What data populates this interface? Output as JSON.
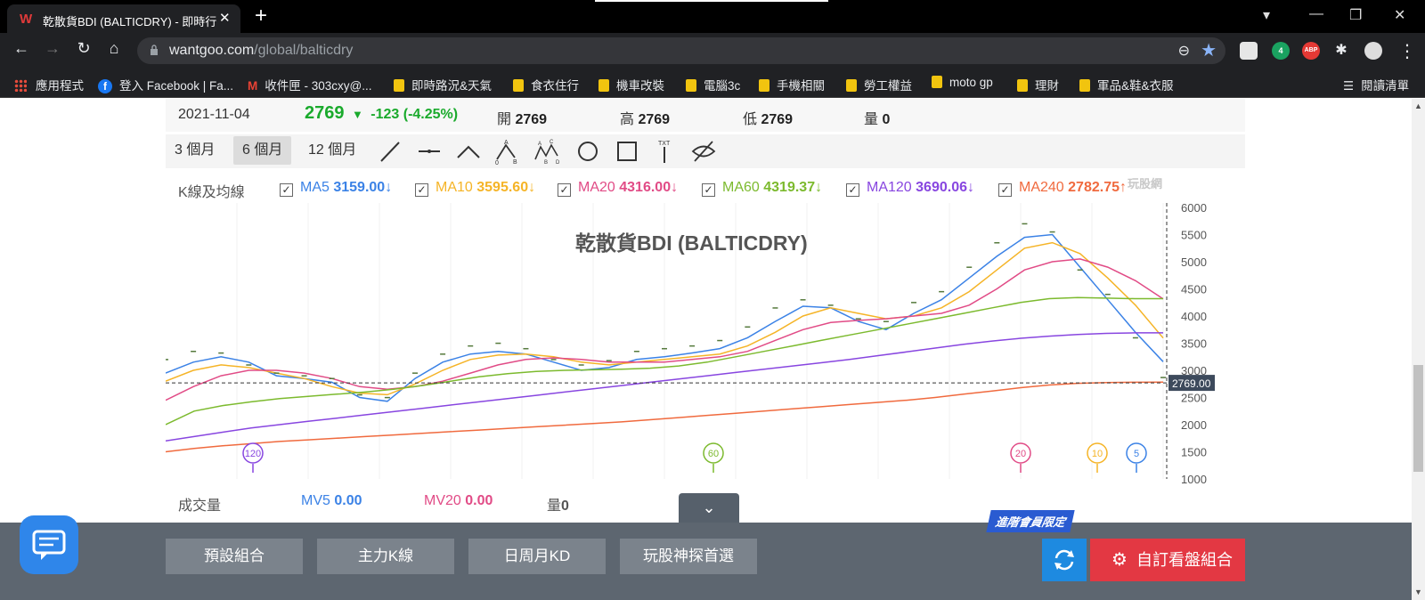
{
  "browser": {
    "tab_title": "乾散貨BDI (BALTICDRY) - 即時行",
    "tab_logo": "W",
    "url_host": "wantgoo.com",
    "url_path": "/global/balticdry",
    "ext_badge": "4",
    "ext_abp": "ABP"
  },
  "bookmarks": [
    {
      "label": "應用程式",
      "icon": "apps-icon"
    },
    {
      "label": "登入 Facebook | Fa...",
      "icon": "facebook-icon"
    },
    {
      "label": "收件匣 - 303cxy@...",
      "icon": "gmail-icon"
    },
    {
      "label": "即時路況&天氣",
      "icon": "folder-icon"
    },
    {
      "label": "食衣住行",
      "icon": "folder-icon"
    },
    {
      "label": "機車改裝",
      "icon": "folder-icon"
    },
    {
      "label": "電腦3c",
      "icon": "folder-icon"
    },
    {
      "label": "手機相關",
      "icon": "folder-icon"
    },
    {
      "label": "勞工權益",
      "icon": "folder-icon"
    },
    {
      "label": "moto gp",
      "icon": "folder-icon"
    },
    {
      "label": "理財",
      "icon": "folder-icon"
    },
    {
      "label": "軍品&鞋&衣服",
      "icon": "folder-icon"
    }
  ],
  "reading_list": "閱讀清單",
  "quote": {
    "date": "2021-11-04",
    "price": "2769",
    "change": "-123 (-4.25%)",
    "open_label": "開",
    "open": "2769",
    "high_label": "高",
    "high": "2769",
    "low_label": "低",
    "low": "2769",
    "volume_label": "量",
    "volume": "0"
  },
  "periods": [
    "3 個月",
    "6 個月",
    "12 個月"
  ],
  "active_period": "6 個月",
  "ma_section_label": "K線及均線",
  "ma_lines": [
    {
      "name": "MA5",
      "value": "3159.00",
      "arrow": "↓",
      "color": "#3b82e6"
    },
    {
      "name": "MA10",
      "value": "3595.60",
      "arrow": "↓",
      "color": "#f5b427"
    },
    {
      "name": "MA20",
      "value": "4316.00",
      "arrow": "↓",
      "color": "#e14b86"
    },
    {
      "name": "MA60",
      "value": "4319.37",
      "arrow": "↓",
      "color": "#7cba2e"
    },
    {
      "name": "MA120",
      "value": "3690.06",
      "arrow": "↓",
      "color": "#8846e0"
    },
    {
      "name": "MA240",
      "value": "2782.75",
      "arrow": "↑",
      "color": "#f06a3e"
    }
  ],
  "watermark": "玩股網",
  "volume_section": {
    "label": "成交量",
    "mv5_name": "MV5",
    "mv5": "0.00",
    "mv20_name": "MV20",
    "mv20": "0.00",
    "vol_name": "量",
    "vol": "0"
  },
  "footer": {
    "buttons": [
      "預設組合",
      "主力K線",
      "日周月KD",
      "玩股神探首選"
    ],
    "badge": "進階會員限定",
    "custom_button": "自訂看盤組合"
  },
  "chart_data": {
    "type": "line",
    "title": "乾散貨BDI (BALTICDRY)",
    "ylim": [
      1000,
      6000
    ],
    "y_ticks": [
      6000,
      5500,
      5000,
      4500,
      4000,
      3500,
      3000,
      2500,
      2000,
      1500,
      1000
    ],
    "current_price_label": "2769.00",
    "current_price": 2769,
    "period_markers": [
      "120",
      "60",
      "20",
      "10",
      "5"
    ],
    "series": [
      {
        "name": "MA5",
        "color": "#3b82e6",
        "values": [
          2950,
          3150,
          3250,
          3150,
          2900,
          2850,
          2780,
          2500,
          2430,
          2850,
          3150,
          3300,
          3350,
          3300,
          3150,
          3000,
          3050,
          3200,
          3250,
          3320,
          3400,
          3600,
          3900,
          4180,
          4150,
          3900,
          3750,
          4050,
          4300,
          4700,
          5100,
          5450,
          5500,
          4900,
          4300,
          3700,
          3159
        ]
      },
      {
        "name": "MA10",
        "color": "#f5b427",
        "values": [
          2800,
          3000,
          3100,
          3050,
          2950,
          2850,
          2700,
          2580,
          2550,
          2750,
          3000,
          3200,
          3280,
          3300,
          3250,
          3150,
          3100,
          3150,
          3200,
          3250,
          3300,
          3450,
          3700,
          4000,
          4150,
          4050,
          3950,
          4000,
          4150,
          4450,
          4850,
          5250,
          5350,
          5150,
          4700,
          4200,
          3595
        ]
      },
      {
        "name": "MA20",
        "color": "#e14b86",
        "values": [
          2450,
          2700,
          2900,
          3000,
          3000,
          2950,
          2850,
          2700,
          2650,
          2700,
          2800,
          2950,
          3100,
          3200,
          3230,
          3200,
          3150,
          3150,
          3150,
          3200,
          3250,
          3350,
          3550,
          3750,
          3880,
          3920,
          3950,
          4000,
          4050,
          4200,
          4500,
          4850,
          5000,
          5050,
          4900,
          4650,
          4316
        ]
      },
      {
        "name": "MA60",
        "color": "#7cba2e",
        "values": [
          2000,
          2250,
          2350,
          2420,
          2480,
          2520,
          2560,
          2600,
          2650,
          2720,
          2800,
          2880,
          2940,
          2980,
          3000,
          3010,
          3020,
          3040,
          3080,
          3150,
          3250,
          3350,
          3450,
          3550,
          3650,
          3750,
          3850,
          3950,
          4050,
          4150,
          4250,
          4320,
          4340,
          4330,
          4320,
          4319
        ]
      },
      {
        "name": "MA120",
        "color": "#8846e0",
        "values": [
          1700,
          1780,
          1860,
          1940,
          2000,
          2060,
          2120,
          2180,
          2240,
          2300,
          2360,
          2420,
          2480,
          2540,
          2600,
          2660,
          2720,
          2780,
          2840,
          2900,
          2960,
          3020,
          3080,
          3140,
          3200,
          3270,
          3340,
          3410,
          3480,
          3540,
          3590,
          3630,
          3660,
          3680,
          3690,
          3690
        ]
      },
      {
        "name": "MA240",
        "color": "#f06a3e",
        "values": [
          1500,
          1560,
          1610,
          1650,
          1690,
          1720,
          1750,
          1780,
          1810,
          1840,
          1870,
          1900,
          1930,
          1960,
          1990,
          2020,
          2050,
          2090,
          2130,
          2170,
          2210,
          2250,
          2290,
          2330,
          2370,
          2410,
          2450,
          2500,
          2560,
          2620,
          2680,
          2730,
          2760,
          2775,
          2780,
          2782
        ]
      },
      {
        "name": "close",
        "color": "#55793c",
        "values": [
          3100,
          3250,
          3220,
          3000,
          2850,
          2800,
          2750,
          2450,
          2400,
          2850,
          3200,
          3350,
          3400,
          3300,
          3100,
          3000,
          3080,
          3250,
          3300,
          3350,
          3450,
          3700,
          4050,
          4200,
          4100,
          3850,
          3800,
          4150,
          4350,
          4800,
          5250,
          5600,
          5450,
          4750,
          4300,
          3500,
          2769
        ]
      }
    ]
  }
}
